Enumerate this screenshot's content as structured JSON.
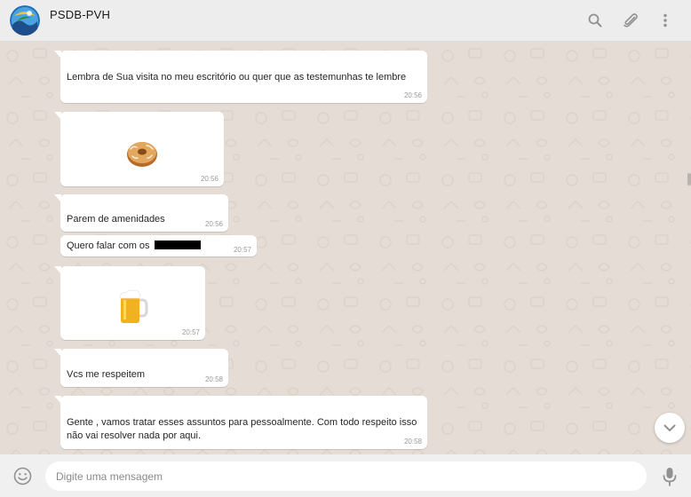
{
  "header": {
    "chat_name": "PSDB-PVH",
    "icons": [
      "search-icon",
      "attach-icon",
      "menu-icon"
    ]
  },
  "messages": [
    {
      "kind": "text",
      "text": "Lembra de Sua visita no meu escritório ou quer que as testemunhas te lembre",
      "time": "20:56"
    },
    {
      "kind": "sticker",
      "sticker": "donut-sticker",
      "time": "20:56"
    },
    {
      "kind": "text",
      "text": "Parem de amenidades",
      "time": "20:56"
    },
    {
      "kind": "text",
      "text": "Quero falar com os",
      "redacted": true,
      "time": "20:57"
    },
    {
      "kind": "sticker",
      "sticker": "beer-sticker",
      "time": "20:57"
    },
    {
      "kind": "text",
      "text": "Vcs me respeitem",
      "time": "20:58"
    },
    {
      "kind": "text",
      "text": "Gente , vamos tratar esses assuntos para pessoalmente. Com todo respeito isso não vai resolver nada por aqui.",
      "time": "20:58"
    }
  ],
  "composer": {
    "placeholder": "Digite uma mensagem",
    "value": ""
  },
  "colors": {
    "chat_background": "#e5ddd5",
    "header_background": "#ededed",
    "bubble_background": "#ffffff",
    "icon_gray": "#919191"
  }
}
